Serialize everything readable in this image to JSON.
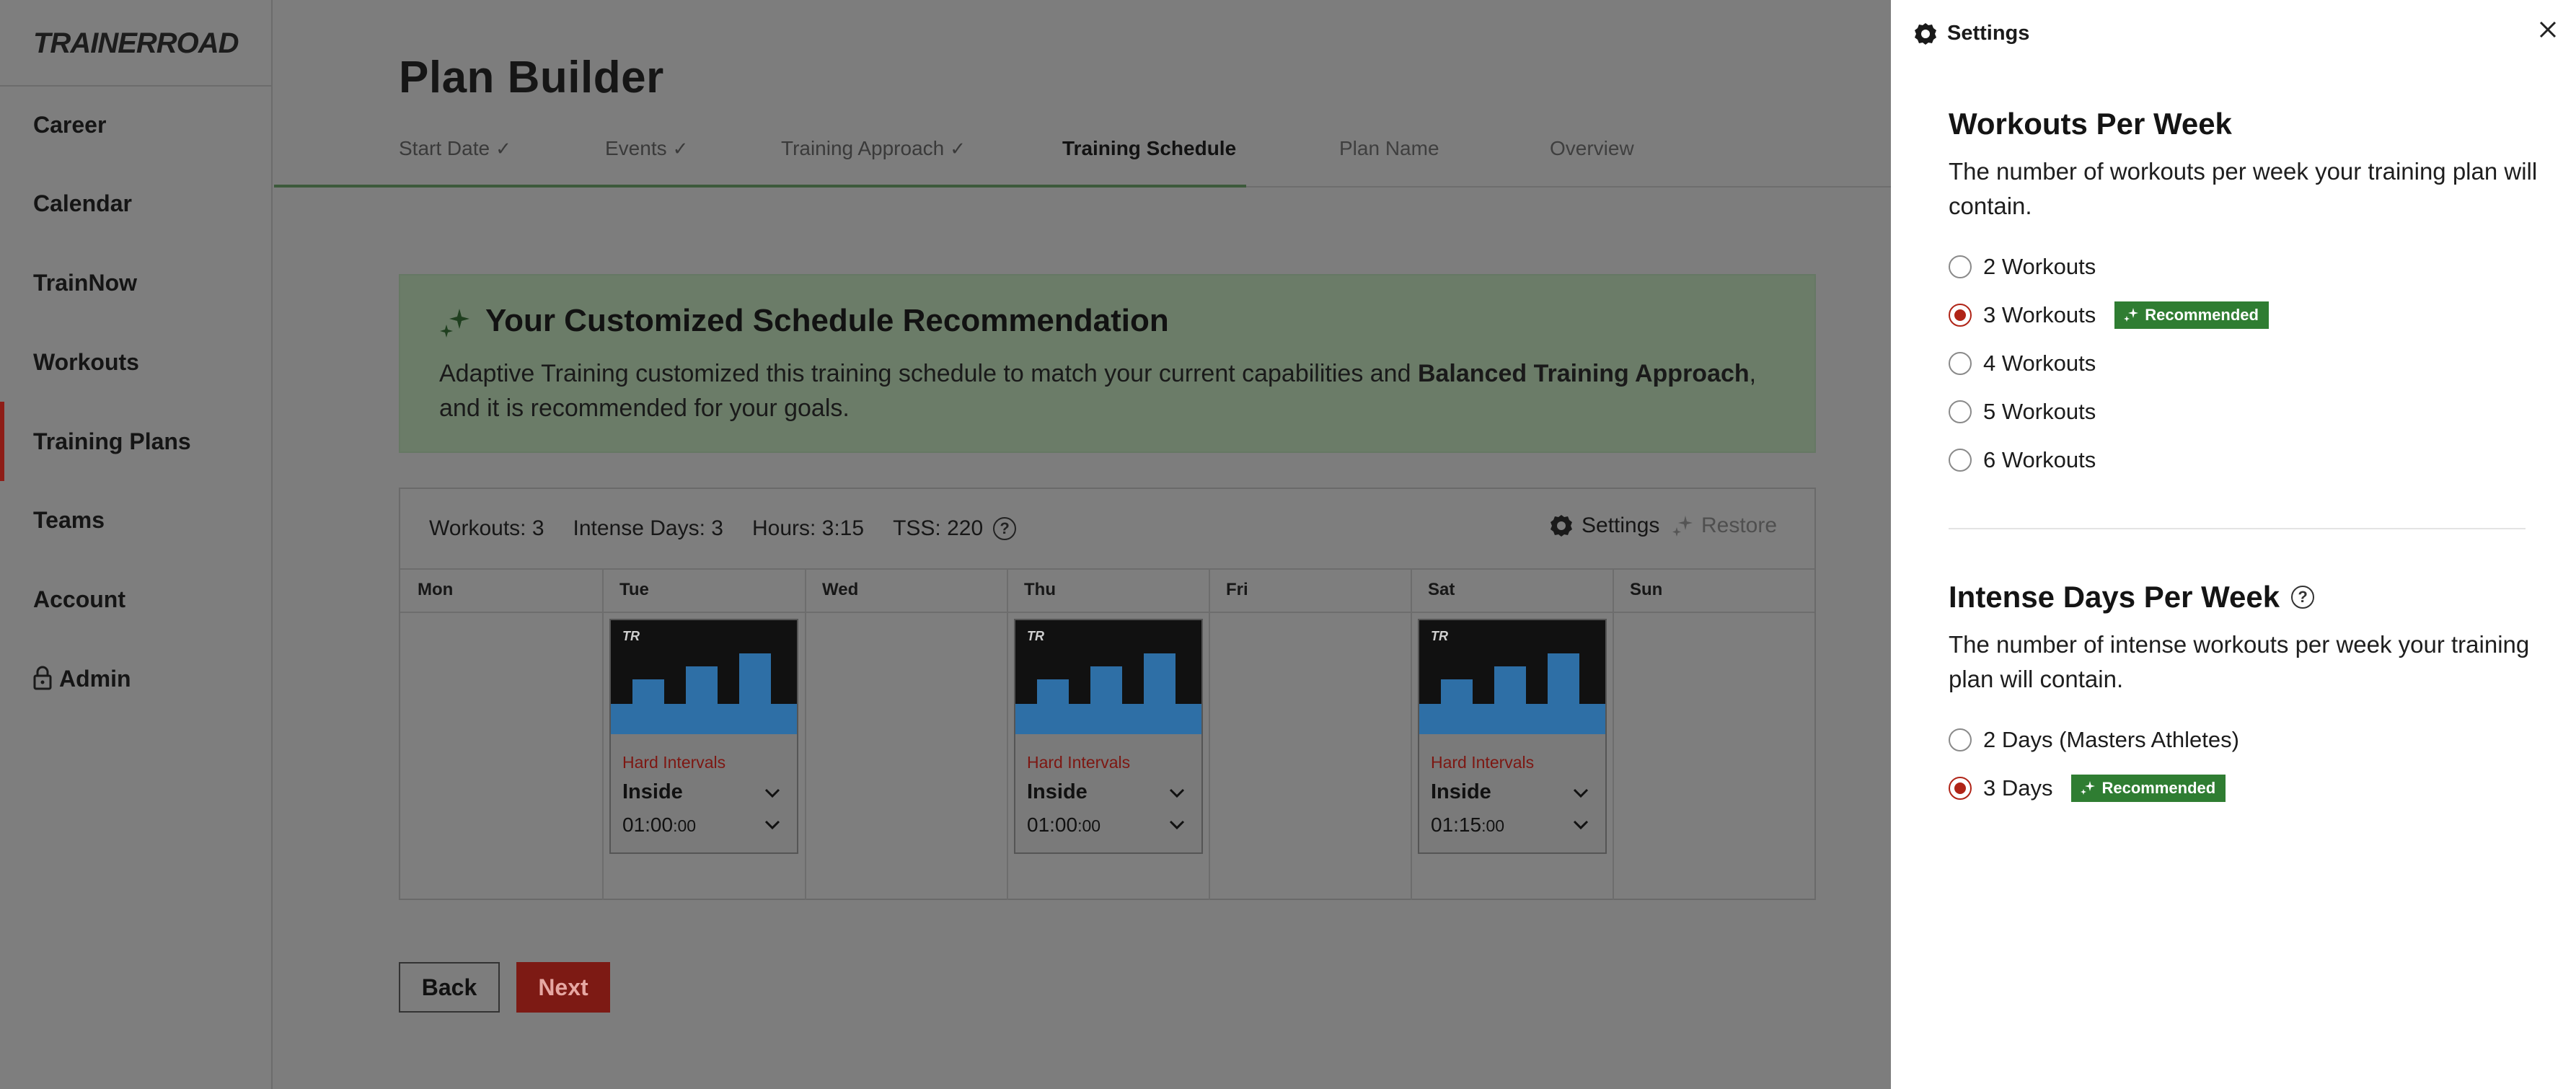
{
  "brand": {
    "logo": "TRAINERROAD"
  },
  "nav": {
    "items": [
      {
        "label": "Career"
      },
      {
        "label": "Calendar"
      },
      {
        "label": "TrainNow"
      },
      {
        "label": "Workouts"
      },
      {
        "label": "Training Plans",
        "active": true
      },
      {
        "label": "Teams"
      },
      {
        "label": "Account"
      },
      {
        "label": "Admin",
        "icon": "lock-icon"
      }
    ]
  },
  "page": {
    "title": "Plan Builder",
    "steps": [
      {
        "label": "Start Date",
        "done": true
      },
      {
        "label": "Events",
        "done": true
      },
      {
        "label": "Training Approach",
        "done": true
      },
      {
        "label": "Training Schedule",
        "current": true
      },
      {
        "label": "Plan Name"
      },
      {
        "label": "Overview"
      }
    ],
    "check": "✓"
  },
  "recommendation": {
    "title": "Your Customized Schedule Recommendation",
    "body_pre": "Adaptive Training customized this training schedule to match your current capabilities and ",
    "body_bold": "Balanced Training Approach",
    "body_post": ", and it is recommended for your goals."
  },
  "schedule": {
    "stats": {
      "workouts": "Workouts: 3",
      "intense_days": "Intense Days: 3",
      "hours": "Hours: 3:15",
      "tss": "TSS: 220"
    },
    "help_glyph": "?",
    "settings_label": "Settings",
    "restore_label": "Restore",
    "days": [
      "Mon",
      "Tue",
      "Wed",
      "Thu",
      "Fri",
      "Sat",
      "Sun"
    ],
    "workouts": [
      {
        "day": "Tue",
        "logo": "TR",
        "type": "Hard Intervals",
        "environment": "Inside",
        "time_main": "01:00",
        "time_sec": ":00"
      },
      {
        "day": "Thu",
        "logo": "TR",
        "type": "Hard Intervals",
        "environment": "Inside",
        "time_main": "01:00",
        "time_sec": ":00"
      },
      {
        "day": "Sat",
        "logo": "TR",
        "type": "Hard Intervals",
        "environment": "Inside",
        "time_main": "01:15",
        "time_sec": ":00"
      }
    ]
  },
  "buttons": {
    "back": "Back",
    "next": "Next"
  },
  "settings_panel": {
    "title": "Settings",
    "workouts_per_week": {
      "title": "Workouts Per Week",
      "description": "The number of workouts per week your training plan will contain.",
      "options": [
        {
          "label": "2 Workouts",
          "selected": false
        },
        {
          "label": "3 Workouts",
          "selected": true,
          "badge": "Recommended"
        },
        {
          "label": "4 Workouts",
          "selected": false
        },
        {
          "label": "5 Workouts",
          "selected": false
        },
        {
          "label": "6 Workouts",
          "selected": false
        }
      ]
    },
    "intense_days_per_week": {
      "title": "Intense Days Per Week",
      "description": "The number of intense workouts per week your training plan will contain.",
      "options": [
        {
          "label": "2 Days (Masters Athletes)",
          "selected": false
        },
        {
          "label": "3 Days",
          "selected": true,
          "badge": "Recommended"
        }
      ]
    }
  },
  "colors": {
    "accent_red": "#b02417",
    "recommended_green": "#2f7d32",
    "chart_blue": "#2e6fa6"
  }
}
